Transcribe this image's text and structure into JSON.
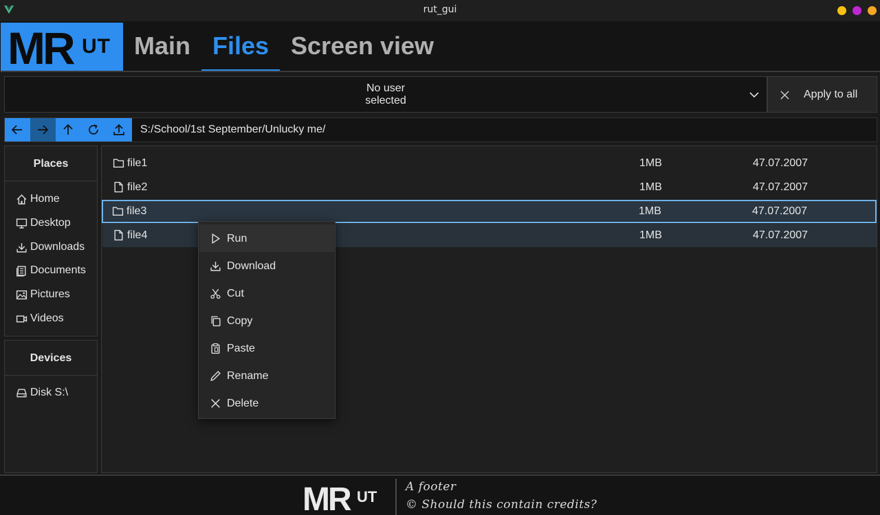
{
  "window": {
    "title": "rut_gui",
    "buttons": [
      {
        "name": "minimize",
        "color": "#f5c211"
      },
      {
        "name": "maximize",
        "color": "#c026d3"
      },
      {
        "name": "close",
        "color": "#f5a623"
      }
    ]
  },
  "header": {
    "logo": "MRUT",
    "tabs": [
      {
        "label": "Main",
        "active": false
      },
      {
        "label": "Files",
        "active": true
      },
      {
        "label": "Screen view",
        "active": false
      }
    ],
    "accent": "#2d8ef0"
  },
  "user_bar": {
    "select_line1": "No user",
    "select_line2": "selected",
    "apply_label": "Apply to all"
  },
  "path_bar": {
    "buttons": [
      "back",
      "forward",
      "up",
      "refresh",
      "upload"
    ],
    "path": "S:/School/1st September/Unlucky me/"
  },
  "sidebar": {
    "places_title": "Places",
    "places": [
      {
        "label": "Home",
        "icon": "home-icon"
      },
      {
        "label": "Desktop",
        "icon": "desktop-icon"
      },
      {
        "label": "Downloads",
        "icon": "download-icon"
      },
      {
        "label": "Documents",
        "icon": "documents-icon"
      },
      {
        "label": "Pictures",
        "icon": "pictures-icon"
      },
      {
        "label": "Videos",
        "icon": "video-icon"
      }
    ],
    "devices_title": "Devices",
    "devices": [
      {
        "label": "Disk S:\\",
        "icon": "disk-icon"
      }
    ]
  },
  "files": [
    {
      "name": "file1",
      "type": "folder",
      "size": "1MB",
      "date": "47.07.2007"
    },
    {
      "name": "file2",
      "type": "file",
      "size": "1MB",
      "date": "47.07.2007"
    },
    {
      "name": "file3",
      "type": "folder",
      "size": "1MB",
      "date": "47.07.2007",
      "selected": true
    },
    {
      "name": "file4",
      "type": "file",
      "size": "1MB",
      "date": "47.07.2007"
    }
  ],
  "context_menu": {
    "items": [
      {
        "label": "Run",
        "icon": "play-icon"
      },
      {
        "label": "Download",
        "icon": "download-icon"
      },
      {
        "label": "Cut",
        "icon": "scissors-icon"
      },
      {
        "label": "Copy",
        "icon": "copy-icon"
      },
      {
        "label": "Paste",
        "icon": "paste-icon"
      },
      {
        "label": "Rename",
        "icon": "pencil-icon"
      },
      {
        "label": "Delete",
        "icon": "x-icon"
      }
    ]
  },
  "footer": {
    "logo": "MRUT",
    "line1": "A footer",
    "line2": "© Should this contain credits?"
  }
}
